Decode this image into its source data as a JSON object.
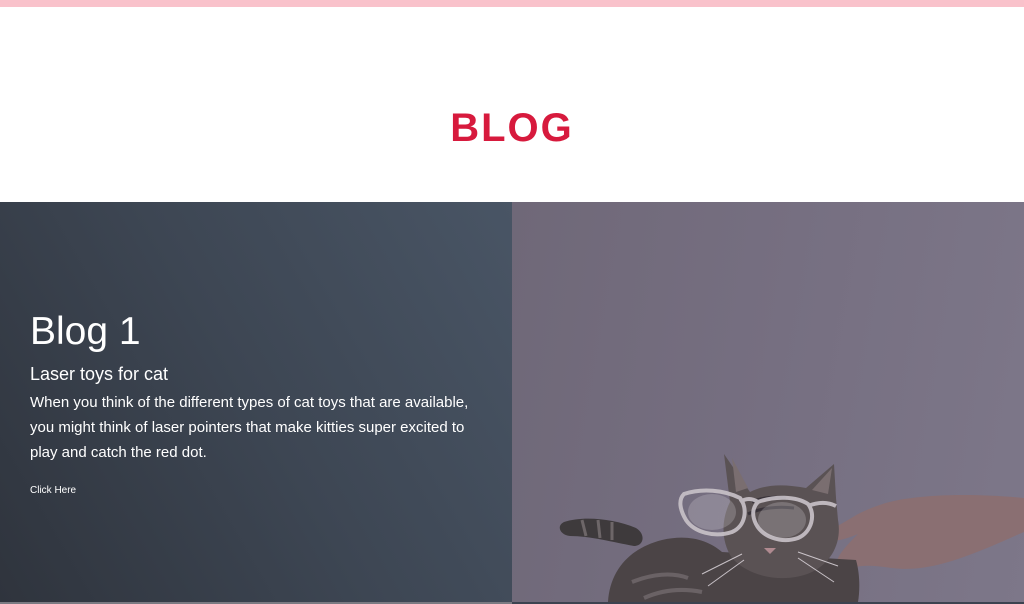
{
  "header": {
    "title": "BLOG"
  },
  "blog_card": {
    "heading": "Blog 1",
    "subtitle": "Laser toys for cat",
    "body": "When you think of the different types of cat toys that are available, you might think of laser pointers that make kitties super excited to play and catch the red dot.",
    "link_label": "Click Here"
  },
  "colors": {
    "accent": "#d71a3d",
    "top_bar": "#f9c2cb",
    "card_background": "#3d4653",
    "photo_tint": "#766f81"
  },
  "photo": {
    "subject_icon": "cat-with-glasses-image"
  }
}
